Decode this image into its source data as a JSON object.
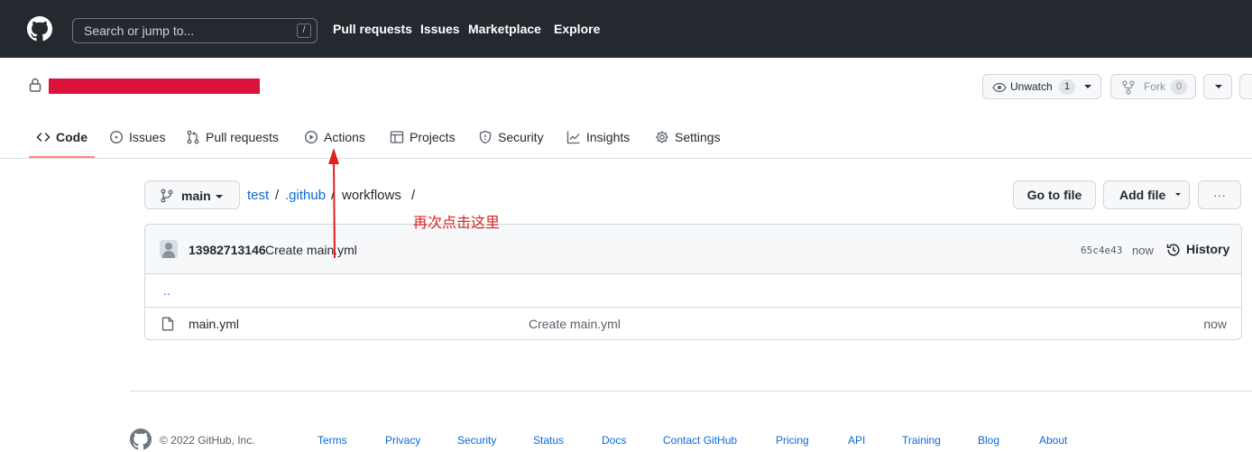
{
  "header": {
    "search_placeholder": "Search or jump to...",
    "search_shortcut": "/",
    "nav": [
      "Pull requests",
      "Issues",
      "Marketplace",
      "Explore"
    ]
  },
  "repo": {
    "unwatch_label": "Unwatch",
    "unwatch_count": "1",
    "fork_label": "Fork",
    "fork_count": "0"
  },
  "tabs": [
    {
      "label": "Code",
      "icon": "code-icon",
      "selected": true
    },
    {
      "label": "Issues",
      "icon": "issue-opened-icon"
    },
    {
      "label": "Pull requests",
      "icon": "git-pull-request-icon"
    },
    {
      "label": "Actions",
      "icon": "play-icon"
    },
    {
      "label": "Projects",
      "icon": "table-icon"
    },
    {
      "label": "Security",
      "icon": "shield-icon"
    },
    {
      "label": "Insights",
      "icon": "graph-icon"
    },
    {
      "label": "Settings",
      "icon": "gear-icon"
    }
  ],
  "filenav": {
    "branch": "main",
    "crumbs": [
      "test",
      ".github",
      "workflows"
    ],
    "sep": "/",
    "go_to_file": "Go to file",
    "add_file": "Add file",
    "more": "···"
  },
  "annotation": "再次点击这里",
  "commit": {
    "author": "13982713146",
    "message": "Create main.yml",
    "sha": "65c4e43",
    "when": "now",
    "history_label": "History"
  },
  "files": {
    "up": "..",
    "rows": [
      {
        "name": "main.yml",
        "message": "Create main.yml",
        "age": "now"
      }
    ]
  },
  "footer": {
    "copyright": "© 2022 GitHub, Inc.",
    "links": [
      "Terms",
      "Privacy",
      "Security",
      "Status",
      "Docs",
      "Contact GitHub",
      "Pricing",
      "API",
      "Training",
      "Blog",
      "About"
    ]
  },
  "colors": {
    "header_bg": "#24292f",
    "link": "#0969da",
    "annotation": "#e02020",
    "redaction": "#dc143c",
    "tab_underline": "#fd8c73"
  }
}
